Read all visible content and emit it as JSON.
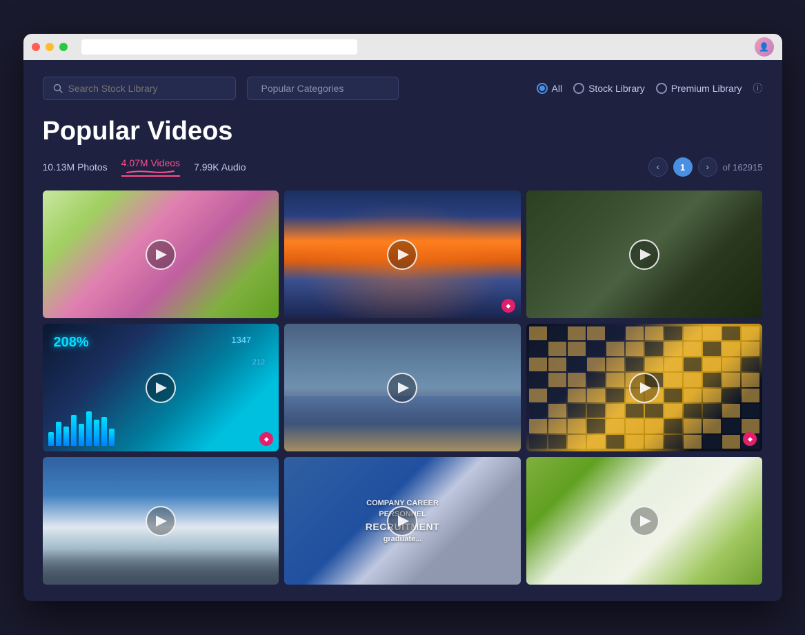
{
  "browser": {
    "url": ""
  },
  "header": {
    "search_placeholder": "Search Stock Library",
    "categories_label": "Popular Categories",
    "filter_options": [
      "All",
      "Stock Library",
      "Premium Library"
    ],
    "active_filter": "All"
  },
  "page": {
    "title": "Popular Videos",
    "stats": {
      "photos": "10.13M Photos",
      "videos": "4.07M Videos",
      "audio": "7.99K Audio",
      "active": "videos"
    },
    "pagination": {
      "current": "1",
      "total_label": "of 162915"
    }
  },
  "videos": [
    {
      "id": 1,
      "type": "flowers",
      "premium": false
    },
    {
      "id": 2,
      "type": "city",
      "premium": true
    },
    {
      "id": 3,
      "type": "flamingo",
      "premium": false
    },
    {
      "id": 4,
      "type": "dataviz",
      "premium": true
    },
    {
      "id": 5,
      "type": "ocean",
      "premium": false
    },
    {
      "id": 6,
      "type": "building",
      "premium": true
    },
    {
      "id": 7,
      "type": "mountain",
      "premium": false
    },
    {
      "id": 8,
      "type": "recruitment",
      "premium": false
    },
    {
      "id": 9,
      "type": "whiteflowers",
      "premium": false
    }
  ],
  "icons": {
    "search": "🔍",
    "play": "▶",
    "chevron_left": "‹",
    "chevron_right": "›",
    "diamond": "◆",
    "info": "ⓘ"
  },
  "colors": {
    "bg": "#1e2140",
    "accent_blue": "#4a90e2",
    "accent_pink": "#ff4d8d",
    "premium": "#e0206a"
  }
}
